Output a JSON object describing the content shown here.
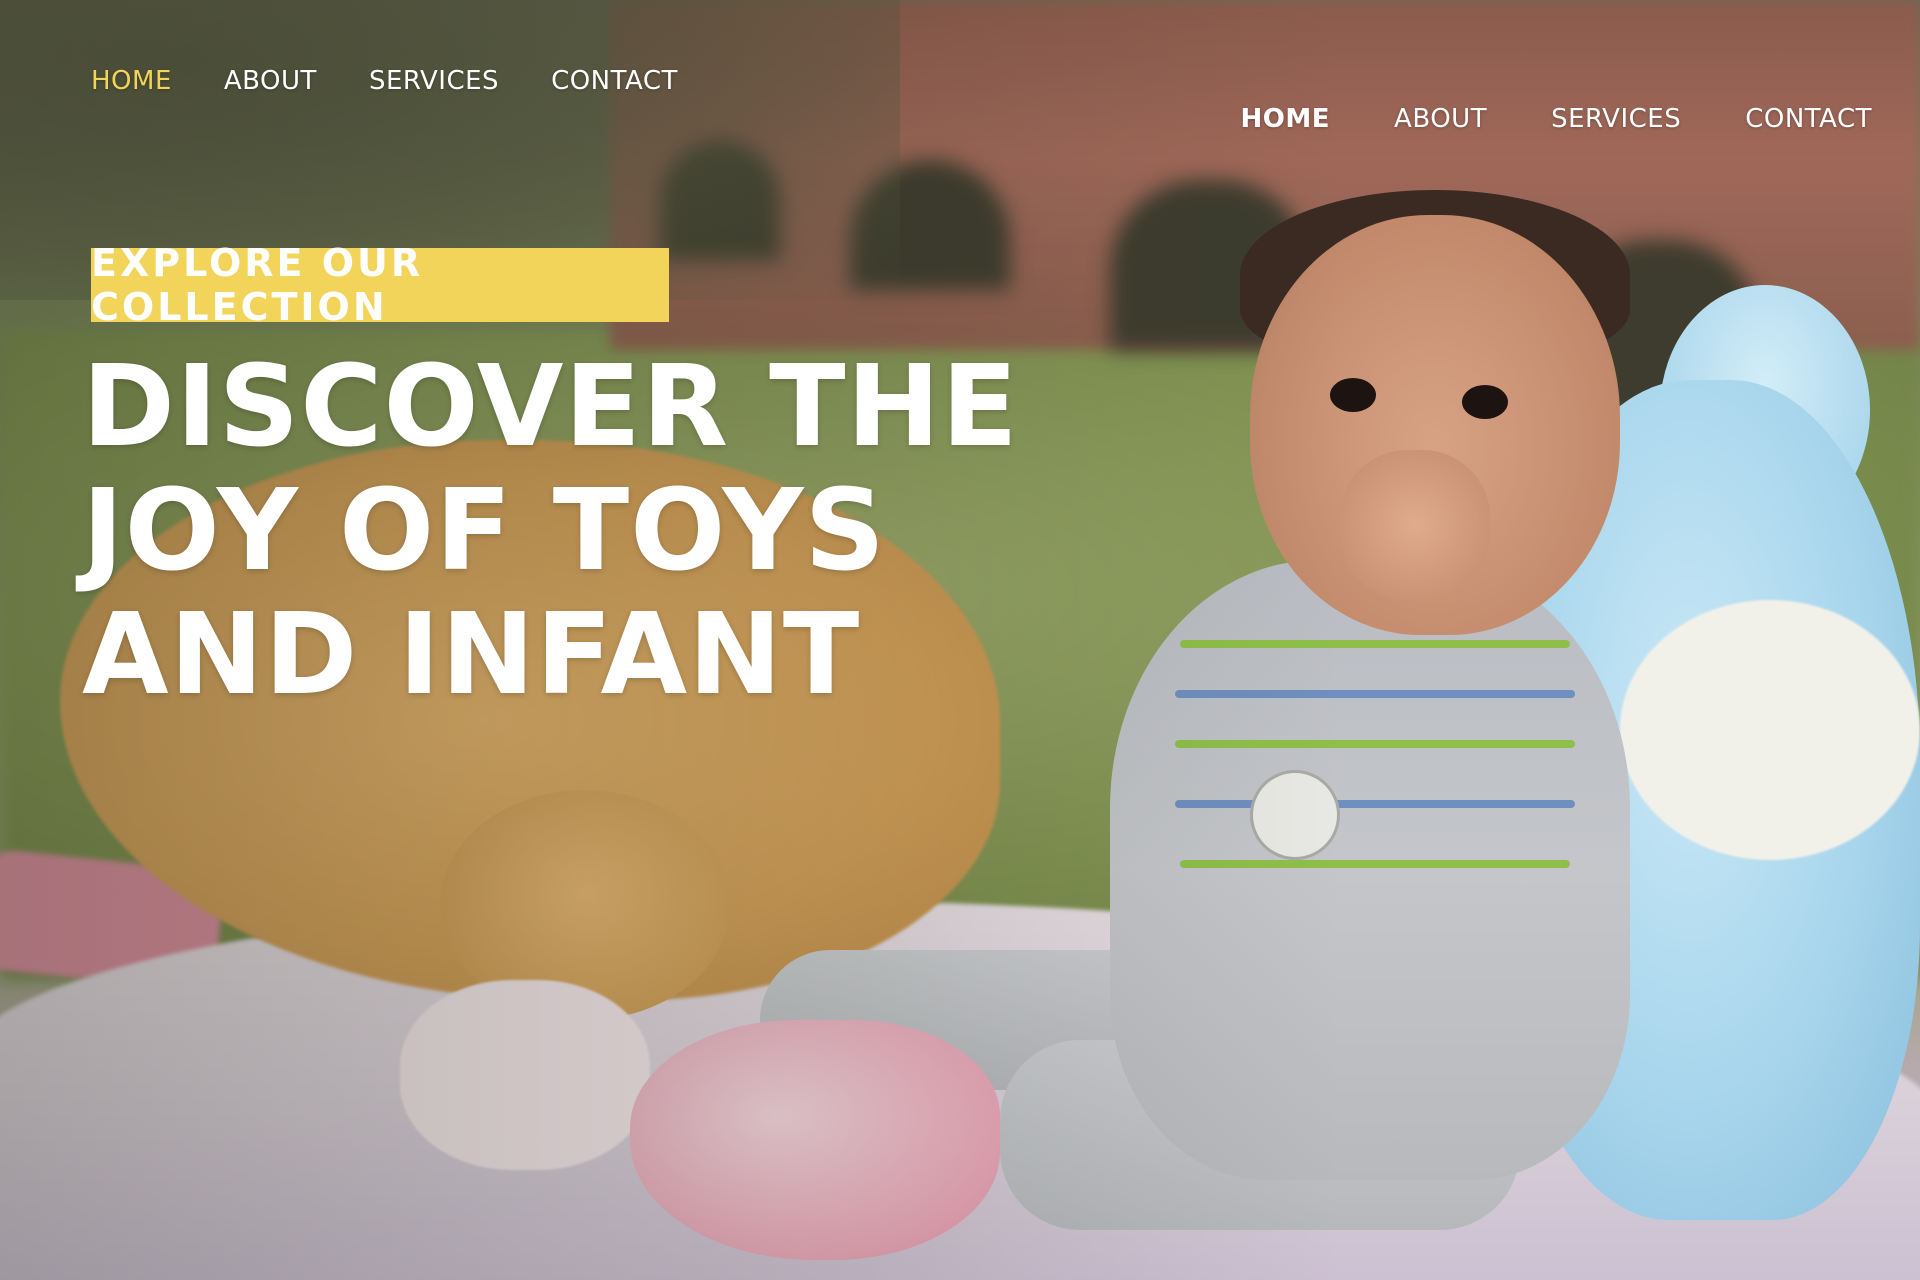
{
  "nav_primary": {
    "items": [
      {
        "label": "HOME",
        "active": true
      },
      {
        "label": "ABOUT"
      },
      {
        "label": "SERVICES"
      },
      {
        "label": "CONTACT"
      }
    ]
  },
  "nav_secondary": {
    "items": [
      {
        "label": "HOME",
        "active": true
      },
      {
        "label": "ABOUT"
      },
      {
        "label": "SERVICES"
      },
      {
        "label": "CONTACT"
      }
    ]
  },
  "hero": {
    "cta_label": "EXPLORE OUR COLLECTION",
    "headline_lines": [
      "DISCOVER THE",
      "JOY OF TOYS",
      "AND INFANT"
    ]
  },
  "colors": {
    "accent": "#f2d45a",
    "text": "#ffffff"
  }
}
